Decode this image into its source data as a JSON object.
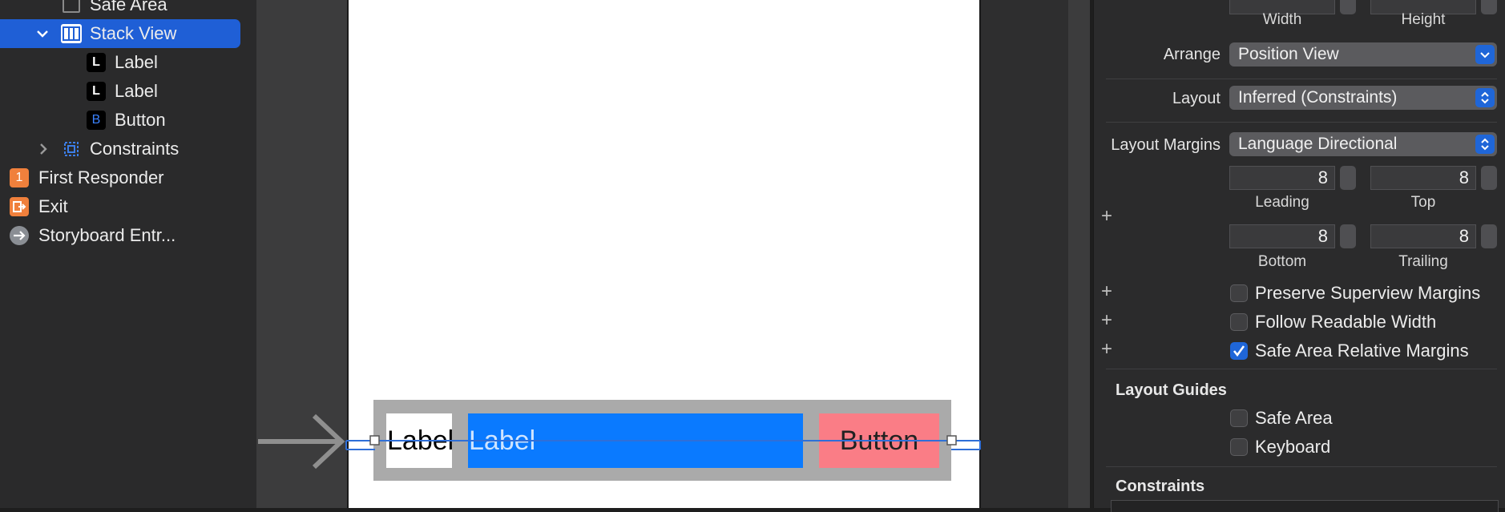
{
  "outline": {
    "items": [
      {
        "label": "Safe Area"
      },
      {
        "label": "Stack View"
      },
      {
        "label": "Label",
        "badge": "L"
      },
      {
        "label": "Label",
        "badge": "L"
      },
      {
        "label": "Button",
        "badge": "B"
      },
      {
        "label": "Constraints"
      },
      {
        "label": "First Responder",
        "badge": "1"
      },
      {
        "label": "Exit"
      },
      {
        "label": "Storyboard Entr..."
      }
    ]
  },
  "canvas": {
    "stack_items": [
      {
        "label": "Label",
        "color": "#ffffff"
      },
      {
        "label": "Label",
        "color": "#0a7aff"
      },
      {
        "label": "Button",
        "color": "#fa7d86"
      }
    ]
  },
  "inspector": {
    "size_labels": {
      "width": "Width",
      "height": "Height"
    },
    "arrange": {
      "label": "Arrange",
      "value": "Position View"
    },
    "layout": {
      "label": "Layout",
      "value": "Inferred (Constraints)"
    },
    "margins": {
      "label": "Layout Margins",
      "value": "Language Directional",
      "leading": {
        "value": "8",
        "label": "Leading"
      },
      "top": {
        "value": "8",
        "label": "Top"
      },
      "bottom": {
        "value": "8",
        "label": "Bottom"
      },
      "trailing": {
        "value": "8",
        "label": "Trailing"
      }
    },
    "checkboxes": [
      {
        "label": "Preserve Superview Margins",
        "checked": false
      },
      {
        "label": "Follow Readable Width",
        "checked": false
      },
      {
        "label": "Safe Area Relative Margins",
        "checked": true
      }
    ],
    "layout_guides": {
      "title": "Layout Guides",
      "items": [
        {
          "label": "Safe Area",
          "checked": false
        },
        {
          "label": "Keyboard",
          "checked": false
        }
      ]
    },
    "constraints_title": "Constraints"
  },
  "colors": {
    "accent": "#1f66d8",
    "selection": "#1f5fd6",
    "orange_badge": "#f0803c"
  }
}
